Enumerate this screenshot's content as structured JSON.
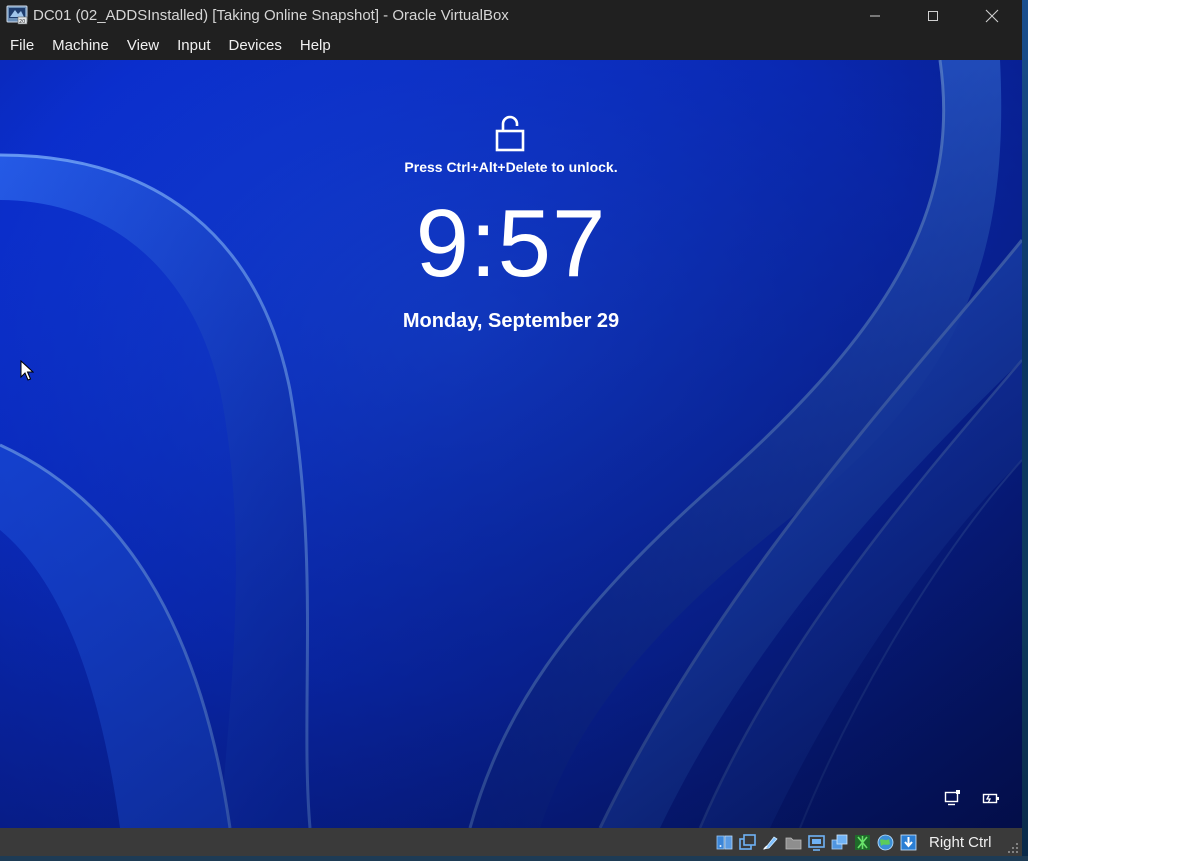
{
  "window": {
    "title": "DC01 (02_ADDSInstalled) [Taking Online Snapshot] - Oracle VirtualBox",
    "app_icon": "virtualbox-vm-icon",
    "controls": [
      "minimize-icon",
      "maximize-icon",
      "close-icon"
    ]
  },
  "menubar": {
    "items": [
      {
        "label": "File"
      },
      {
        "label": "Machine"
      },
      {
        "label": "View"
      },
      {
        "label": "Input"
      },
      {
        "label": "Devices"
      },
      {
        "label": "Help"
      }
    ]
  },
  "lockscreen": {
    "icon": "unlocked-padlock-icon",
    "hint": "Press Ctrl+Alt+Delete to unlock.",
    "time": "9:57",
    "date": "Monday, September 29",
    "corner_icons": [
      "network-icon",
      "power-battery-icon"
    ]
  },
  "statusbar": {
    "icons": [
      "hard-disk-icon",
      "optical-drive-icon",
      "audio-icon",
      "shared-folders-icon",
      "display-icon",
      "video-capture-icon",
      "mouse-integration-icon",
      "network-globe-icon",
      "keyboard-capture-icon"
    ],
    "host_key": "Right Ctrl"
  },
  "colors": {
    "titlebar_bg": "#202020",
    "statusbar_bg": "#3a3a3a",
    "wallpaper_base": "#0a2fd0"
  }
}
